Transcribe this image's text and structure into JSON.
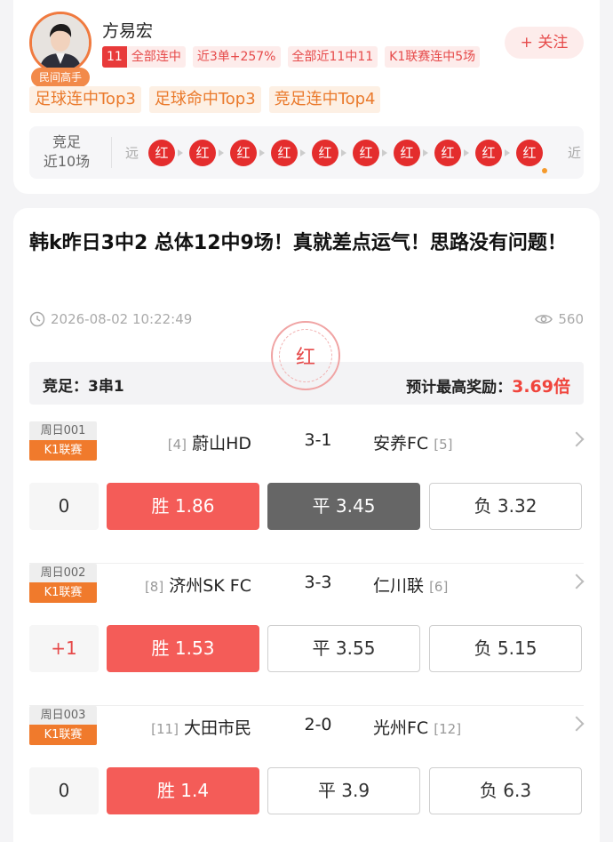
{
  "profile": {
    "name": "方易宏",
    "badge": "民间高手",
    "streak_count": "11",
    "tags": [
      "全部连中",
      "近3单+257%",
      "全部近11中11",
      "K1联赛连中5场"
    ],
    "follow_label": "+ 关注",
    "honors": [
      "足球连中Top3",
      "足球命中Top3",
      "竞足连中Top4"
    ],
    "recent": {
      "label_line1": "竞足",
      "label_line2": "近10场",
      "far": "远",
      "near": "近",
      "results": [
        "红",
        "红",
        "红",
        "红",
        "红",
        "红",
        "红",
        "红",
        "红",
        "红"
      ]
    }
  },
  "post": {
    "title": "韩k昨日3中2 总体12中9场！真就差点运气！思路没有问题！",
    "time": "2026-08-02 10:22:49",
    "views": "560",
    "stamp": "红",
    "play_type": "竞足：3串1",
    "bonus_label": "预计最高奖励：",
    "bonus_value": "3.69倍",
    "matches": [
      {
        "weekday": "周日001",
        "league": "K1联赛",
        "home_rank": "[4]",
        "home": "蔚山HD",
        "score": "3-1",
        "away": "安养FC",
        "away_rank": "[5]",
        "handicap": "0",
        "win": "胜 1.86",
        "draw": "平 3.45",
        "lose": "负 3.32",
        "win_state": "hit",
        "draw_state": "pick",
        "lose_state": "none"
      },
      {
        "weekday": "周日002",
        "league": "K1联赛",
        "home_rank": "[8]",
        "home": "济州SK FC",
        "score": "3-3",
        "away": "仁川联",
        "away_rank": "[6]",
        "handicap": "+1",
        "win": "胜 1.53",
        "draw": "平 3.55",
        "lose": "负 5.15",
        "win_state": "hit",
        "draw_state": "none",
        "lose_state": "none"
      },
      {
        "weekday": "周日003",
        "league": "K1联赛",
        "home_rank": "[11]",
        "home": "大田市民",
        "score": "2-0",
        "away": "光州FC",
        "away_rank": "[12]",
        "handicap": "0",
        "win": "胜 1.4",
        "draw": "平 3.9",
        "lose": "负 6.3",
        "win_state": "hit",
        "draw_state": "none",
        "lose_state": "none"
      }
    ]
  },
  "colors": {
    "accent_red": "#e42d2d",
    "hit_red": "#f45c58",
    "selected_gray": "#666666",
    "league_orange": "#f07a2c",
    "honor_orange": "#ea7a2c"
  }
}
